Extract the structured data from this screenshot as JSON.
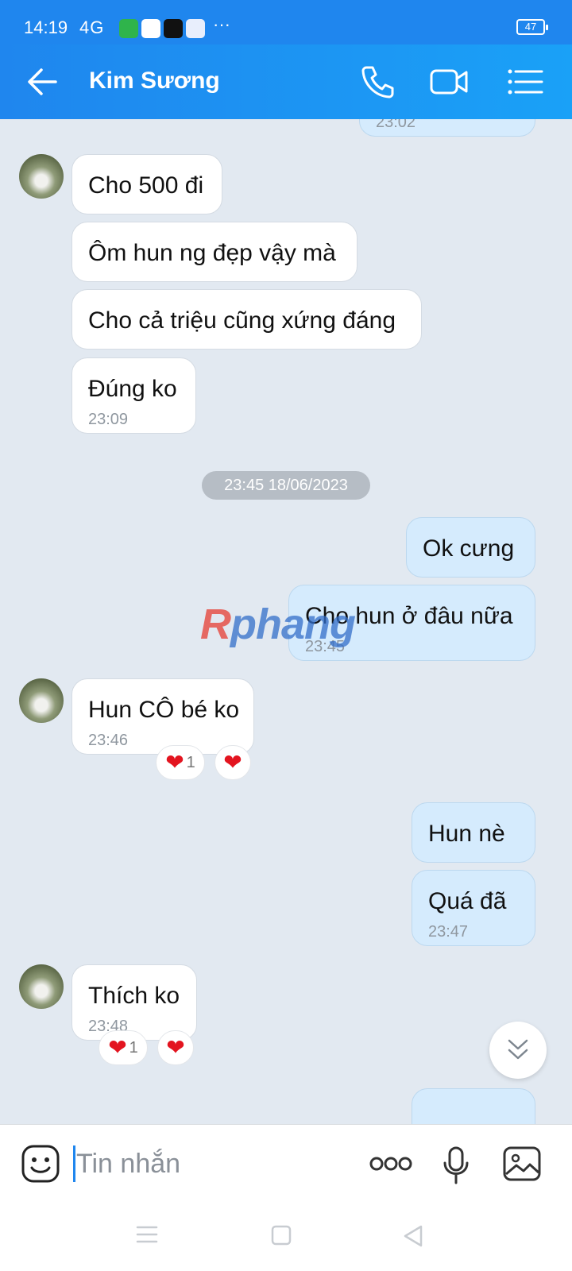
{
  "status": {
    "time": "14:19",
    "network": "4G",
    "battery": "47"
  },
  "header": {
    "contact_name": "Kim Sương"
  },
  "messages": [
    {
      "time": "23:02"
    },
    {
      "text": "Cho 500 đi"
    },
    {
      "text": "Ôm hun ng đẹp vậy mà"
    },
    {
      "text": "Cho cả triệu cũng xứng đáng"
    },
    {
      "text": "Đúng ko",
      "time": "23:09"
    },
    {
      "text": "Ok cưng"
    },
    {
      "text": "Cho hun ở đâu nữa",
      "time": "23:45"
    },
    {
      "text": "Hun CÔ bé ko",
      "time": "23:46",
      "reaction_count": "1"
    },
    {
      "text": "Hun nè"
    },
    {
      "text": "Quá đã",
      "time": "23:47"
    },
    {
      "text": "Thích ko",
      "time": "23:48",
      "reaction_count": "1"
    }
  ],
  "date_separator": "23:45 18/06/2023",
  "watermark": {
    "first": "R",
    "rest": "phang"
  },
  "input": {
    "placeholder": "Tin nhắn"
  },
  "icons": {
    "back": "arrow-left-icon",
    "call": "phone-icon",
    "video": "video-camera-icon",
    "menu": "list-menu-icon",
    "emoji": "emoji-icon",
    "more": "more-dots-icon",
    "mic": "microphone-icon",
    "image": "image-icon",
    "scroll": "chevrons-down-icon"
  },
  "colors": {
    "header": "#1f86ee",
    "outgoing_bubble": "#d5ebfd",
    "incoming_bubble": "#ffffff",
    "background": "#e2e9f1",
    "heart": "#e3141f"
  }
}
